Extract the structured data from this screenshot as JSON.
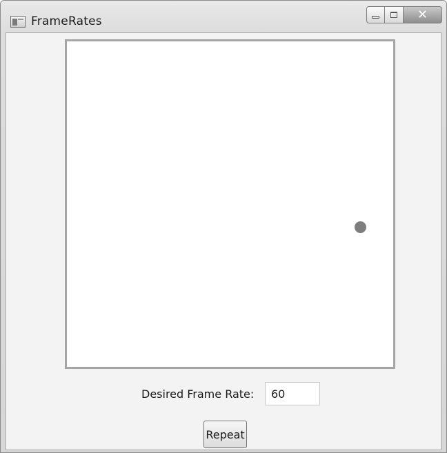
{
  "window": {
    "title": "FrameRates",
    "icon": "window-app-icon",
    "caption_buttons": [
      "minimize-icon",
      "maximize-icon",
      "close-icon"
    ]
  },
  "canvas": {
    "ball_color": "#7d7d7d",
    "border_color": "#a5a5a5"
  },
  "frame_rate": {
    "label": "Desired Frame Rate:",
    "value": "60"
  },
  "repeat_button": {
    "label": "Repeat"
  },
  "colors": {
    "client_background": "#f3f3f3",
    "canvas_background": "#ffffff"
  }
}
